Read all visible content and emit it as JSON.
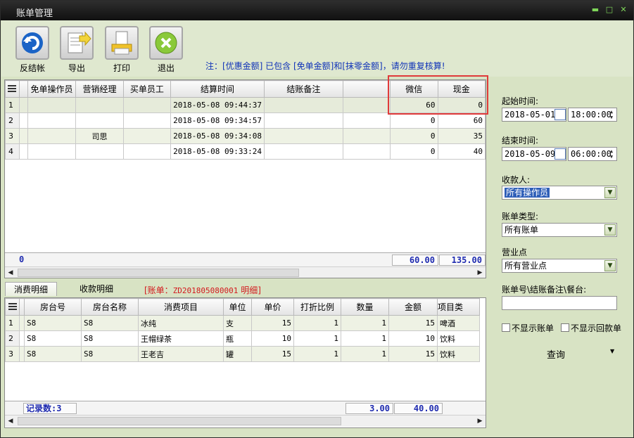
{
  "window": {
    "title": "账单管理",
    "btn_min": "▬",
    "btn_max": "□",
    "btn_close": "✕"
  },
  "toolbar": {
    "buttons": [
      {
        "label": "反结帐",
        "icon": "undo-icon"
      },
      {
        "label": "导出",
        "icon": "export-icon"
      },
      {
        "label": "打印",
        "icon": "print-icon"
      },
      {
        "label": "退出",
        "icon": "exit-icon"
      }
    ],
    "note": "注：[优惠金额] 已包含 [免单金额]和[抹零金额]，请勿重复核算!"
  },
  "bills": {
    "columns": [
      "免单操作员",
      "营销经理",
      "买单员工",
      "结算时间",
      "结账备注",
      "",
      "微信",
      "现金"
    ],
    "rows": [
      {
        "n": "1",
        "free_op": "",
        "manager": "",
        "buyer": "",
        "time": "2018-05-08 09:44:37",
        "note": "",
        "blank": "",
        "wechat": "60",
        "cash": "0"
      },
      {
        "n": "2",
        "free_op": "",
        "manager": "",
        "buyer": "",
        "time": "2018-05-08 09:34:57",
        "note": "",
        "blank": "",
        "wechat": "0",
        "cash": "60"
      },
      {
        "n": "3",
        "free_op": "",
        "manager": "司思",
        "buyer": "",
        "time": "2018-05-08 09:34:08",
        "note": "",
        "blank": "",
        "wechat": "0",
        "cash": "35"
      },
      {
        "n": "4",
        "free_op": "",
        "manager": "",
        "buyer": "",
        "time": "2018-05-08 09:33:24",
        "note": "",
        "blank": "",
        "wechat": "0",
        "cash": "40"
      }
    ],
    "summary": {
      "first": "0",
      "wechat_total": "60.00",
      "cash_total": "135.00"
    }
  },
  "tabs": [
    {
      "label": "消费明细",
      "active": true
    },
    {
      "label": "收款明细",
      "active": false
    }
  ],
  "bill_detail_label": {
    "prefix": "[账单：",
    "code": "ZD201805080001",
    "suffix": " 明细]"
  },
  "details": {
    "columns": [
      "房台号",
      "房台名称",
      "消费项目",
      "单位",
      "单价",
      "打折比例",
      "数量",
      "金额",
      "项目类"
    ],
    "rows": [
      {
        "n": "1",
        "room_no": "S8",
        "room_name": "S8",
        "item": "冰纯",
        "unit": "支",
        "price": "15",
        "discount": "1",
        "qty": "1",
        "amount": "15",
        "type": "啤酒"
      },
      {
        "n": "2",
        "room_no": "S8",
        "room_name": "S8",
        "item": "王帽绿茶",
        "unit": "瓶",
        "price": "10",
        "discount": "1",
        "qty": "1",
        "amount": "10",
        "type": "饮料"
      },
      {
        "n": "3",
        "room_no": "S8",
        "room_name": "S8",
        "item": "王老吉",
        "unit": "罐",
        "price": "15",
        "discount": "1",
        "qty": "1",
        "amount": "15",
        "type": "饮料"
      }
    ],
    "summary": {
      "records": "记录数:3",
      "qty_total": "3.00",
      "amount_total": "40.00"
    }
  },
  "filters": {
    "start_label": "起始时间:",
    "start_date": "2018-05-01",
    "start_time": "18:00:00",
    "end_label": "结束时间:",
    "end_date": "2018-05-09",
    "end_time": "06:00:00",
    "payee_label": "收款人:",
    "payee_value": "所有操作员",
    "bill_type_label": "账单类型:",
    "bill_type_value": "所有账单",
    "outlet_label": "营业点",
    "outlet_value": "所有营业点",
    "search_label": "账单号\\结账备注\\餐台:",
    "search_value": "",
    "hide_bills": "不显示账单",
    "hide_refund": "不显示回款单",
    "query": "查询"
  },
  "colors": {
    "accent_blue": "#1033b8",
    "alert_red": "#d3191d",
    "panel_bg": "#d8e3c4",
    "highlight_border": "#e03a3a"
  }
}
